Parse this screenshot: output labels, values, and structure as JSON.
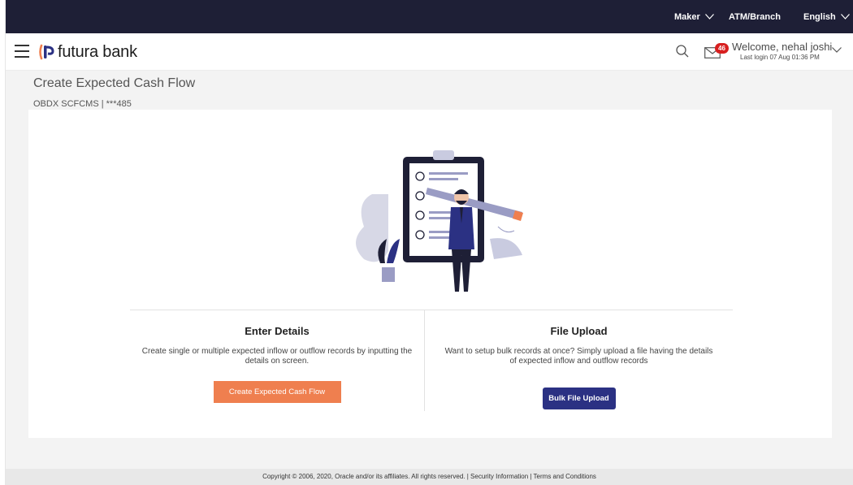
{
  "topbar": {
    "role": "Maker",
    "atm_branch": "ATM/Branch",
    "language": "English"
  },
  "header": {
    "brand": "futura bank",
    "notifications_count": "46",
    "welcome": "Welcome, nehal joshi",
    "last_login": "Last login 07 Aug 01:36 PM"
  },
  "page": {
    "title": "Create Expected Cash Flow",
    "subtitle": "OBDX SCFCMS | ***485"
  },
  "options": {
    "enter_details": {
      "title": "Enter Details",
      "description": "Create single or multiple expected inflow or outflow records by inputting the details on screen.",
      "button": "Create Expected Cash Flow"
    },
    "file_upload": {
      "title": "File Upload",
      "description": "Want to setup bulk records at once? Simply upload a file having the details of expected inflow and outflow records",
      "button": "Bulk File Upload"
    }
  },
  "footer": {
    "text": "Copyright © 2006, 2020, Oracle and/or its affiliates. All rights reserved. | Security Information | Terms and Conditions"
  },
  "colors": {
    "topbar": "#1e1f36",
    "primary_button": "#ef7f4f",
    "secondary_button": "#2b3183",
    "badge": "#d81f1f"
  }
}
